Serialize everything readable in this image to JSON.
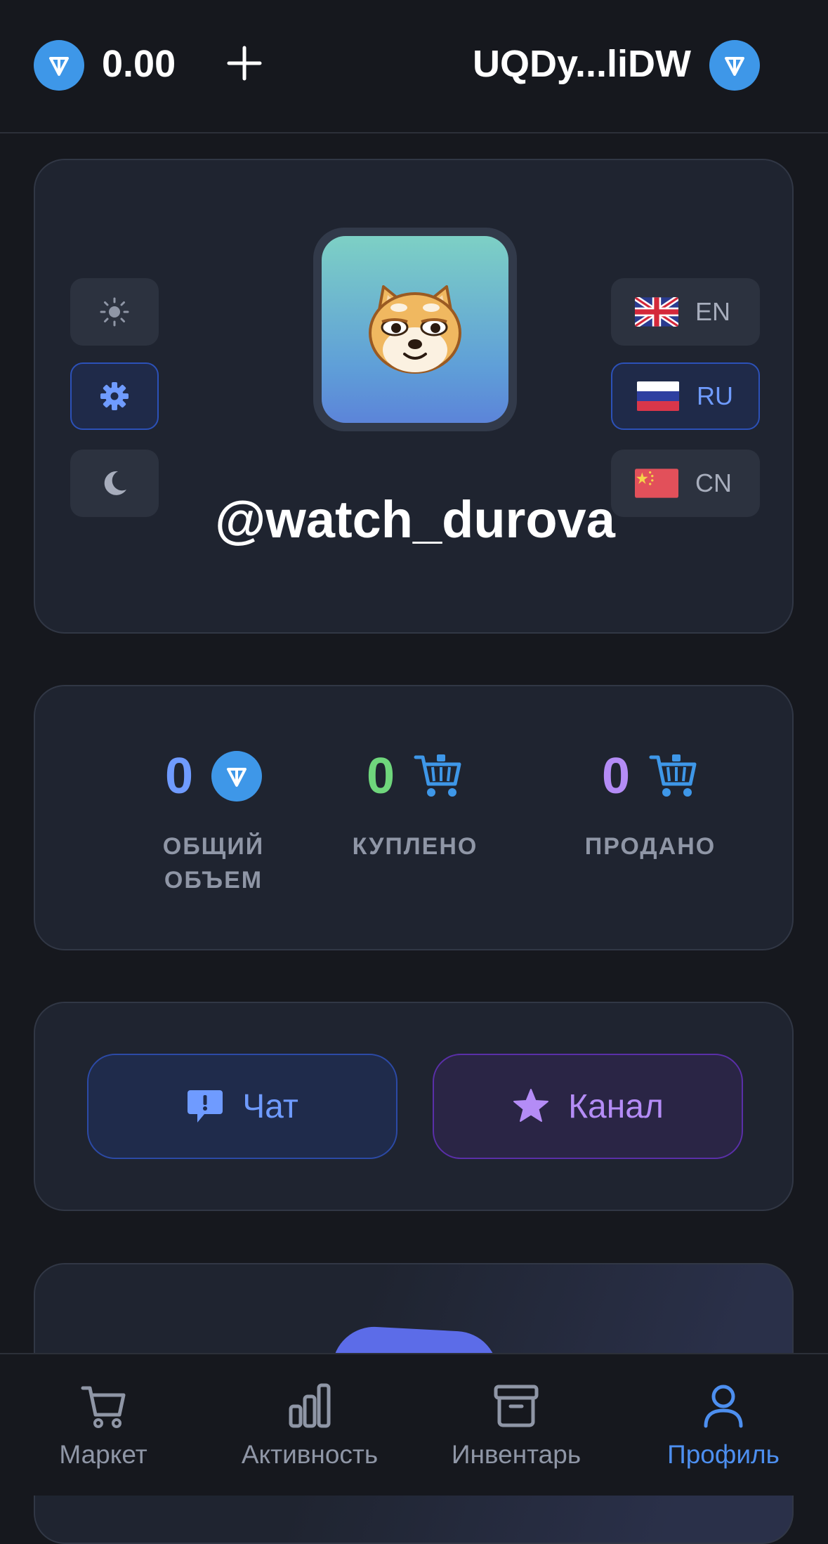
{
  "header": {
    "balance": "0.00",
    "wallet_address": "UQDy...liDW"
  },
  "profile": {
    "username": "@watch_durova",
    "themes": [
      {
        "name": "light",
        "icon": "sun-icon",
        "active": false
      },
      {
        "name": "system",
        "icon": "gear-icon",
        "active": true
      },
      {
        "name": "dark",
        "icon": "moon-icon",
        "active": false
      }
    ],
    "languages": [
      {
        "code": "EN",
        "active": false
      },
      {
        "code": "RU",
        "active": true
      },
      {
        "code": "CN",
        "active": false
      }
    ]
  },
  "stats": [
    {
      "value": "0",
      "label": "ОБЩИЙ ОБЪЕМ",
      "icon": "ton-icon",
      "color": "#6f9bff"
    },
    {
      "value": "0",
      "label": "КУПЛЕНО",
      "icon": "cart-icon",
      "color": "#6fd67c"
    },
    {
      "value": "0",
      "label": "ПРОДАНО",
      "icon": "cart-icon",
      "color": "#b48cf6"
    }
  ],
  "links": {
    "chat_label": "Чат",
    "channel_label": "Канал"
  },
  "nav": {
    "items": [
      {
        "label": "Маркет",
        "icon": "cart-icon"
      },
      {
        "label": "Активность",
        "icon": "bar-chart-icon"
      },
      {
        "label": "Инвентарь",
        "icon": "archive-icon"
      },
      {
        "label": "Профиль",
        "icon": "user-icon",
        "active": true
      }
    ]
  },
  "colors": {
    "accent": "#3e97e8",
    "background": "#16181e",
    "card": "#1f2430"
  }
}
